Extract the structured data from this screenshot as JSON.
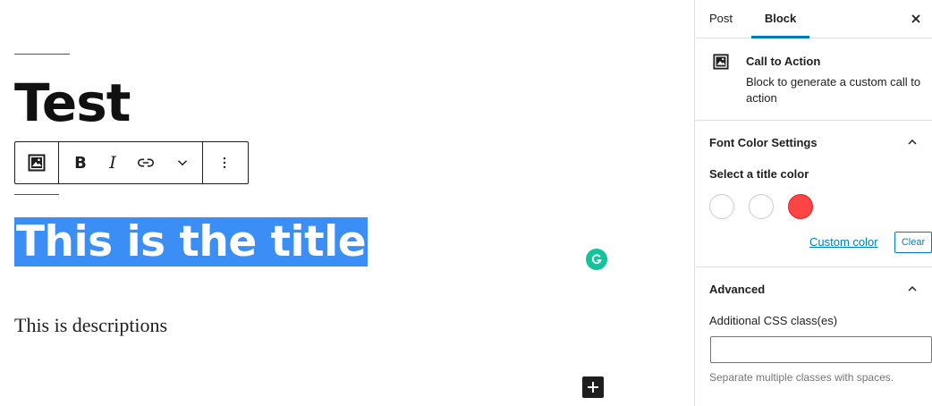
{
  "editor": {
    "post_title": "Test",
    "block_title": "This is the title",
    "block_description": "This is descriptions",
    "toolbar": {
      "bold_label": "B",
      "italic_label": "I"
    },
    "selection_color": "#3a8ef6"
  },
  "sidebar": {
    "tabs": [
      {
        "label": "Post",
        "active": false
      },
      {
        "label": "Block",
        "active": true
      }
    ],
    "close_icon": "close-icon",
    "block_card": {
      "name": "Call to Action",
      "description": "Block to generate a custom call to action"
    },
    "font_panel": {
      "title": "Font Color Settings",
      "select_label": "Select a title color",
      "swatches": [
        "#ffffff",
        "#ffffff",
        "#ff4444"
      ],
      "custom_color_label": "Custom color",
      "clear_label": "Clear"
    },
    "advanced_panel": {
      "title": "Advanced",
      "css_label": "Additional CSS class(es)",
      "css_value": "",
      "help_text": "Separate multiple classes with spaces."
    }
  },
  "colors": {
    "accent": "#007cba",
    "grammarly": "#15c39a"
  }
}
